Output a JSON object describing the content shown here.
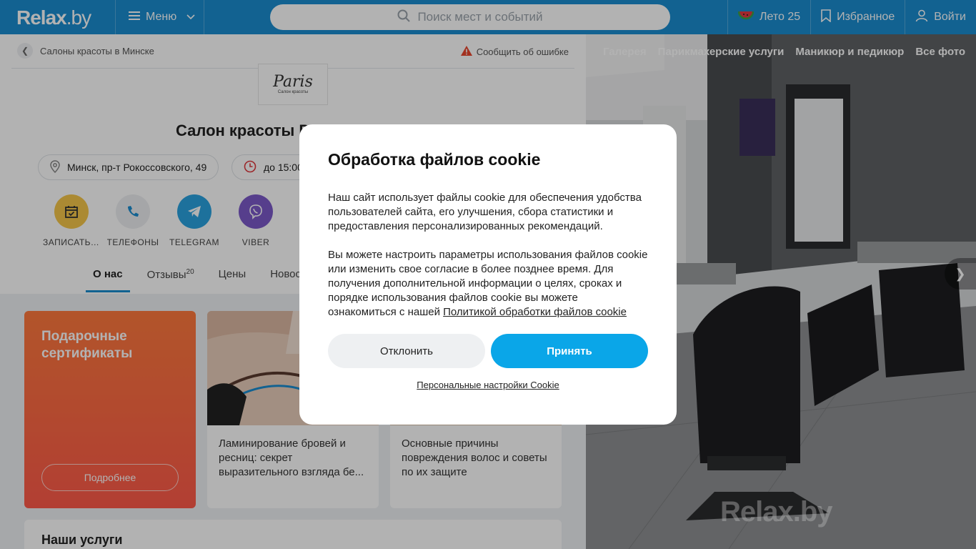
{
  "header": {
    "logo_main": "Relax",
    "logo_tld": ".by",
    "menu_label": "Меню",
    "search_placeholder": "Поиск мест и событий",
    "summer_label": "Лето 25",
    "favorites_label": "Избранное",
    "login_label": "Войти"
  },
  "breadcrumb": {
    "label": "Салоны красоты в Минске"
  },
  "report_error": "Сообщить об ошибке",
  "salon": {
    "logo_script": "Paris",
    "logo_subtitle": "Салон красоты",
    "title": "Салон красоты P... (P...)",
    "address": "Минск, пр-т Рокоссовского, 49",
    "hours": "до 15:00"
  },
  "actions": [
    {
      "label": "ЗАПИСАТЬСЯ",
      "icon": "calendar-icon",
      "color": "#f5c64a"
    },
    {
      "label": "ТЕЛЕФОНЫ",
      "icon": "phone-icon",
      "color": "#eceef1"
    },
    {
      "label": "TELEGRAM",
      "icon": "telegram-icon",
      "color": "#2aa3e0"
    },
    {
      "label": "VIBER",
      "icon": "viber-icon",
      "color": "#7b59c9"
    }
  ],
  "tabs": [
    {
      "label": "О нас"
    },
    {
      "label": "Отзывы",
      "count": "20"
    },
    {
      "label": "Цены"
    },
    {
      "label": "Новости"
    }
  ],
  "gift_card": {
    "title": "Подарочные сертификаты",
    "button": "Подробнее"
  },
  "articles": [
    {
      "text": "Ламинирование бровей и ресниц: секрет выразительного взгляда бе..."
    },
    {
      "text": "Основные причины повреждения волос и советы по их защите"
    }
  ],
  "services_title": "Наши услуги",
  "gallery": {
    "tabs": [
      "Галерея",
      "Парикмахерские услуги",
      "Маникюр и педикюр",
      "Все фото"
    ],
    "watermark": "Relax.by"
  },
  "cookie": {
    "title": "Обработка файлов cookie",
    "para1": "Наш сайт использует файлы cookie для обеспечения удобства пользователей сайта, его улучшения, сбора статистики и предоставления персонализированных рекомендаций.",
    "para2": "Вы можете настроить параметры использования файлов cookie или изменить свое согласие в более позднее время. Для получения дополнительной информации о целях, сроках и порядке использования файлов cookie вы можете ознакомиться с нашей ",
    "policy_link": "Политикой обработки файлов cookie",
    "decline": "Отклонить",
    "accept": "Принять",
    "personal": "Персональные настройки Cookie"
  }
}
